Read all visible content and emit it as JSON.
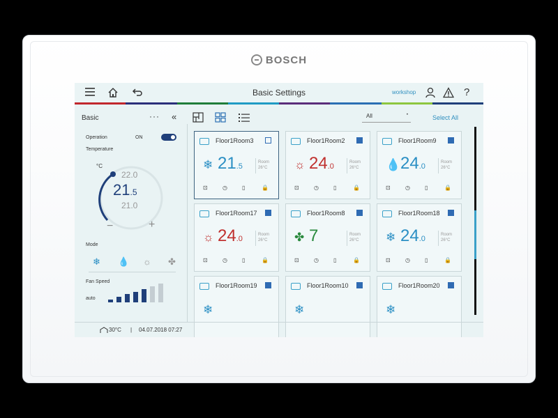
{
  "brand": "BOSCH",
  "topbar": {
    "title": "Basic Settings",
    "site": "workshop",
    "menu_icon": "menu-icon",
    "home_icon": "home-icon",
    "back_icon": "back-icon",
    "user_icon": "user-icon",
    "warning_icon": "warning-icon",
    "help": "?",
    "strip_colors": [
      "#c1272d",
      "#2b2f7a",
      "#1f7d3a",
      "#1f9bc4",
      "#5a2d7a",
      "#2b6fb3",
      "#8dc63f",
      "#1f3f7a"
    ]
  },
  "toolbar": {
    "panel_title": "Basic",
    "more": "···",
    "collapse": "«",
    "filter_value": "All",
    "select_all": "Select All"
  },
  "left_panel": {
    "operation_label": "Operation",
    "operation_state": "ON",
    "temperature_label": "Temperature",
    "unit": "°C",
    "setpoint_int": "21",
    "setpoint_dec": ".5",
    "setpoint_up": "22.0",
    "setpoint_down": "21.0",
    "minus": "−",
    "plus": "+",
    "mode_label": "Mode",
    "fan_label": "Fan Speed",
    "fan_auto": "auto",
    "fan_level": 0.7
  },
  "rooms": [
    {
      "name": "Floor1Room3",
      "mode": "cool",
      "temp": "21",
      "dec": ".5",
      "room": "Room",
      "set": "26°C",
      "checked": "edit"
    },
    {
      "name": "Floor1Room2",
      "mode": "heat",
      "temp": "24",
      "dec": ".0",
      "room": "Room",
      "set": "26°C",
      "checked": "on"
    },
    {
      "name": "Floor1Room9",
      "mode": "dry",
      "temp": "24",
      "dec": ".0",
      "room": "Room",
      "set": "26°C",
      "checked": "on"
    },
    {
      "name": "Floor1Room17",
      "mode": "heat",
      "temp": "24",
      "dec": ".0",
      "room": "Room",
      "set": "26°C",
      "checked": "on"
    },
    {
      "name": "Floor1Room8",
      "mode": "fan",
      "temp": "7",
      "dec": "",
      "room": "Room",
      "set": "26°C",
      "checked": "on"
    },
    {
      "name": "Floor1Room18",
      "mode": "cool",
      "temp": "24",
      "dec": ".0",
      "room": "Room",
      "set": "26°C",
      "checked": "on"
    },
    {
      "name": "Floor1Room19",
      "mode": "cool",
      "temp": "",
      "dec": "",
      "room": "",
      "set": "",
      "checked": "on"
    },
    {
      "name": "Floor1Room10",
      "mode": "cool",
      "temp": "",
      "dec": "",
      "room": "",
      "set": "",
      "checked": "on"
    },
    {
      "name": "Floor1Room20",
      "mode": "cool",
      "temp": "",
      "dec": "",
      "room": "",
      "set": "",
      "checked": "on"
    }
  ],
  "status": {
    "outdoor_temp": "30°C",
    "datetime": "04.07.2018 07:27"
  },
  "colors": {
    "cool": "#2b8fc4",
    "heat": "#c0312f",
    "fan": "#2a8a3e",
    "accent": "#1f3f7a"
  }
}
